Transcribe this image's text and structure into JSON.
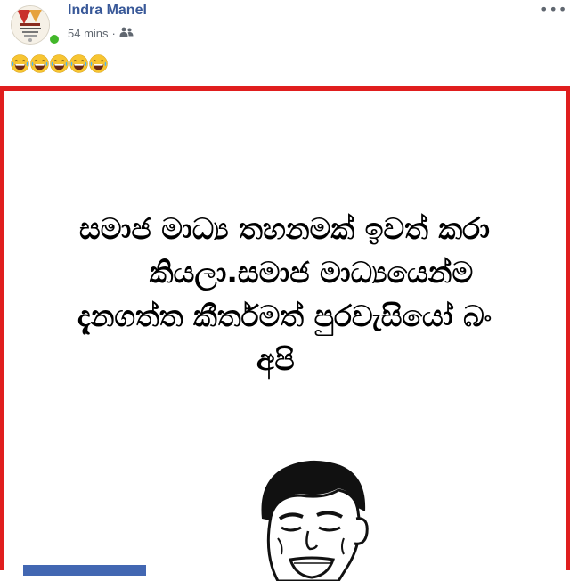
{
  "post": {
    "author": "Indra Manel",
    "timestamp": "54 mins",
    "separator": "·",
    "audience_icon": "friends-icon",
    "more_icon": "more-options-icon",
    "caption_emojis": [
      "😂",
      "😂",
      "😂",
      "😂",
      "😂"
    ]
  },
  "meme": {
    "lines": [
      "සමාජ මාධ්‍ය තහනමක් ඉවත් කරා",
      "කියලා.සමාජ මාධ්‍යයෙන්ම",
      "දැනගත්ත කීර්තමත්  පුරවැසියෝ බං",
      "අපි"
    ]
  },
  "colors": {
    "frame_border": "#e01e1e",
    "author_link": "#385898",
    "meta_text": "#606770",
    "online": "#42b72a",
    "bottom_bar": "#4267b2"
  }
}
